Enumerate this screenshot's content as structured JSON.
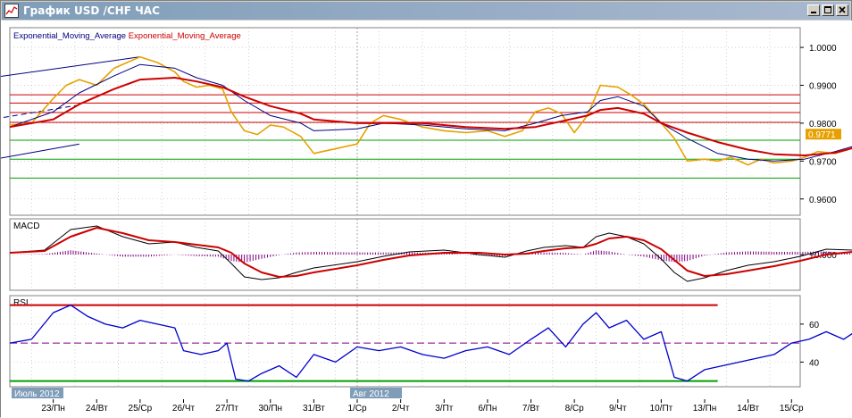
{
  "window": {
    "title": "График USD /CHF ЧАС",
    "controls": [
      "minimize",
      "maximize",
      "close"
    ],
    "app_icon": "chart-icon"
  },
  "colors": {
    "background": "#ffffff",
    "grid": "#b4b4b4",
    "price": "#e6a100",
    "ema_fast": "#000080",
    "ema_slow": "#cc0000",
    "channel": "#000080",
    "resistance": "#cc0000",
    "support": "#00a000",
    "macd_hist": "#800080",
    "rsi": "#0000cc",
    "rsi_overbought": "#cc0000",
    "rsi_oversold": "#00a000",
    "rsi_mid": "#800080",
    "price_tag": "#e6a100"
  },
  "chart_data": [
    {
      "type": "line",
      "panel": "price",
      "legend": [
        "Exponential_Moving_Average",
        "Exponential_Moving_Average"
      ],
      "y_ticks": [
        "1.0000",
        "0.9900",
        "0.9800",
        "0.9700",
        "0.9600"
      ],
      "ylim": [
        0.9557,
        1.0052
      ],
      "current_price": "0.9771",
      "horizontal_levels": {
        "resistance": [
          0.9875,
          0.9853,
          0.9828,
          0.9802
        ],
        "support": [
          0.9755,
          0.9705,
          0.9655
        ]
      },
      "trendlines": [
        {
          "name": "upper channel",
          "from": [
            25,
            0.9975
          ],
          "to": [
            15.2,
            0.9818
          ]
        },
        {
          "name": "middle channel",
          "from": [
            23.6,
            0.9848
          ],
          "to": [
            15.2,
            0.969
          ]
        },
        {
          "name": "lower channel",
          "from": [
            23.6,
            0.9745
          ],
          "to": [
            15.2,
            0.9572
          ]
        }
      ],
      "series": [
        {
          "name": "",
          "role": "price",
          "x": [
            22,
            22.5,
            23,
            23.3,
            23.6,
            24,
            24.4,
            24.8,
            25,
            25.4,
            25.8,
            26,
            26.3,
            26.6,
            26.9,
            27.1,
            27.4,
            27.7,
            28,
            28.3,
            28.7,
            29,
            30,
            30.3,
            30.6,
            31,
            31.5,
            32,
            32.5,
            33,
            33.4,
            33.8,
            34.1,
            34.4,
            34.7,
            35,
            35.3,
            35.6,
            36,
            36.3,
            36.6,
            37,
            37.3,
            37.6,
            38,
            38.3,
            38.6,
            39,
            39.3,
            39.6,
            40,
            40.3,
            40.6,
            41,
            41.3,
            41.6,
            42,
            42.3,
            42.6,
            43,
            43.3,
            43.6
          ],
          "y": [
            0.9795,
            0.98,
            0.9865,
            0.99,
            0.9915,
            0.99,
            0.9945,
            0.9965,
            0.9975,
            0.996,
            0.9935,
            0.991,
            0.9895,
            0.99,
            0.989,
            0.983,
            0.978,
            0.977,
            0.9795,
            0.979,
            0.9765,
            0.972,
            0.9745,
            0.98,
            0.982,
            0.981,
            0.979,
            0.978,
            0.9775,
            0.978,
            0.9765,
            0.978,
            0.983,
            0.984,
            0.9825,
            0.9775,
            0.982,
            0.99,
            0.9895,
            0.9875,
            0.985,
            0.98,
            0.976,
            0.97,
            0.9705,
            0.97,
            0.971,
            0.969,
            0.9705,
            0.9695,
            0.97,
            0.971,
            0.9725,
            0.972,
            0.973,
            0.9745,
            0.9775,
            0.9795,
            0.9785,
            0.98,
            0.9775,
            0.9771
          ]
        },
        {
          "name": "",
          "role": "ema_fast",
          "x": [
            22,
            23,
            23.6,
            24.4,
            25,
            25.8,
            26.3,
            26.9,
            27.4,
            28,
            28.7,
            29,
            30,
            30.6,
            31.5,
            32.5,
            33.4,
            34.1,
            34.7,
            35.3,
            35.6,
            36,
            36.6,
            37,
            37.6,
            38.3,
            39,
            39.6,
            40.3,
            41,
            41.6,
            42.3,
            43,
            43.6
          ],
          "y": [
            0.979,
            0.983,
            0.988,
            0.9925,
            0.9955,
            0.9945,
            0.992,
            0.99,
            0.986,
            0.982,
            0.98,
            0.978,
            0.9785,
            0.98,
            0.9795,
            0.9785,
            0.978,
            0.98,
            0.982,
            0.983,
            0.986,
            0.987,
            0.9845,
            0.98,
            0.976,
            0.972,
            0.9705,
            0.97,
            0.9705,
            0.9725,
            0.9745,
            0.9765,
            0.978,
            0.9778
          ]
        },
        {
          "name": "",
          "role": "ema_slow",
          "x": [
            22,
            23,
            23.6,
            24.4,
            25,
            25.8,
            26.3,
            26.9,
            27.4,
            28,
            28.7,
            29,
            30,
            30.6,
            31.5,
            32.5,
            33.4,
            34.1,
            34.7,
            35.3,
            35.6,
            36,
            36.6,
            37,
            37.6,
            38.3,
            39,
            39.6,
            40.3,
            41,
            41.6,
            42.3,
            43,
            43.6
          ],
          "y": [
            0.979,
            0.981,
            0.985,
            0.989,
            0.9915,
            0.992,
            0.991,
            0.9895,
            0.987,
            0.9845,
            0.9825,
            0.981,
            0.98,
            0.98,
            0.98,
            0.979,
            0.9785,
            0.979,
            0.9805,
            0.982,
            0.9835,
            0.984,
            0.9825,
            0.98,
            0.9775,
            0.975,
            0.973,
            0.9718,
            0.9715,
            0.9722,
            0.974,
            0.9752,
            0.976,
            0.9762
          ]
        }
      ]
    },
    {
      "type": "line",
      "panel": "macd",
      "label": "MACD",
      "y_ticks": [
        "+0.000"
      ],
      "ylim": [
        -0.004,
        0.004
      ],
      "series": [
        {
          "name": "",
          "role": "macd",
          "x": [
            22,
            22.8,
            23.4,
            24,
            24.6,
            25.2,
            25.8,
            26.3,
            26.8,
            27.1,
            27.4,
            27.8,
            28.2,
            28.6,
            29,
            30,
            30.6,
            31.2,
            32,
            32.8,
            33.4,
            33.9,
            34.3,
            34.8,
            35.2,
            35.5,
            35.8,
            36.2,
            36.6,
            37,
            37.3,
            37.6,
            38,
            38.5,
            39,
            39.6,
            40.2,
            40.8,
            41.4,
            42,
            42.5,
            43,
            43.6
          ],
          "y": [
            0.0002,
            0.0005,
            0.0028,
            0.0032,
            0.002,
            0.0012,
            0.0014,
            0.0008,
            0.0004,
            -0.001,
            -0.0025,
            -0.0028,
            -0.0026,
            -0.002,
            -0.0015,
            -0.0008,
            -0.0002,
            0.0003,
            0.0005,
            0.0,
            -0.0003,
            0.0004,
            0.0008,
            0.001,
            0.0008,
            0.002,
            0.0024,
            0.002,
            0.0012,
            -0.0005,
            -0.002,
            -0.003,
            -0.0026,
            -0.0018,
            -0.0012,
            -0.0008,
            -0.0002,
            0.0006,
            0.0005,
            0.0012,
            0.0016,
            0.0012,
            0.0006
          ]
        },
        {
          "name": "",
          "role": "signal",
          "x": [
            22,
            22.8,
            23.4,
            24,
            24.6,
            25.2,
            25.8,
            26.3,
            26.8,
            27.1,
            27.4,
            27.8,
            28.2,
            28.6,
            29,
            30,
            30.6,
            31.2,
            32,
            32.8,
            33.4,
            33.9,
            34.3,
            34.8,
            35.2,
            35.5,
            35.8,
            36.2,
            36.6,
            37,
            37.3,
            37.6,
            38,
            38.5,
            39,
            39.6,
            40.2,
            40.8,
            41.4,
            42,
            42.5,
            43,
            43.6
          ],
          "y": [
            0.0002,
            0.0004,
            0.002,
            0.003,
            0.0024,
            0.0016,
            0.0014,
            0.0011,
            0.0008,
            0.0002,
            -0.001,
            -0.002,
            -0.0025,
            -0.0024,
            -0.002,
            -0.0012,
            -0.0006,
            -0.0001,
            0.0002,
            0.0002,
            0.0,
            0.0001,
            0.0004,
            0.0007,
            0.0008,
            0.0012,
            0.0018,
            0.002,
            0.0016,
            0.0006,
            -0.0006,
            -0.0018,
            -0.0024,
            -0.0022,
            -0.0018,
            -0.0013,
            -0.0007,
            0.0,
            0.0003,
            0.0008,
            0.0012,
            0.0012,
            0.0008
          ]
        }
      ]
    },
    {
      "type": "line",
      "panel": "rsi",
      "label": "RSI",
      "y_ticks": [
        "60",
        "40"
      ],
      "ylim": [
        27,
        75
      ],
      "levels": {
        "overbought": 70,
        "middle": 50,
        "oversold": 30
      },
      "series": [
        {
          "name": "",
          "role": "rsi",
          "x": [
            22,
            22.5,
            23,
            23.4,
            23.8,
            24.2,
            24.6,
            25,
            25.4,
            25.8,
            26,
            26.4,
            26.8,
            27,
            27.2,
            27.5,
            27.8,
            28.2,
            28.6,
            29,
            29.5,
            30,
            30.5,
            31,
            31.5,
            32,
            32.5,
            33,
            33.5,
            34,
            34.4,
            34.8,
            35.2,
            35.5,
            35.8,
            36.2,
            36.6,
            37,
            37.3,
            37.6,
            38,
            38.4,
            38.8,
            39.2,
            39.6,
            40,
            40.4,
            40.8,
            41.2,
            41.6,
            42,
            42.3,
            42.6,
            43,
            43.3,
            43.6
          ],
          "y": [
            50,
            52,
            66,
            70,
            64,
            60,
            58,
            62,
            60,
            58,
            46,
            44,
            46,
            50,
            31,
            30,
            34,
            38,
            32,
            44,
            40,
            48,
            46,
            48,
            44,
            42,
            46,
            48,
            44,
            52,
            58,
            48,
            60,
            66,
            58,
            62,
            52,
            56,
            32,
            30,
            36,
            38,
            40,
            42,
            44,
            50,
            52,
            56,
            52,
            58,
            64,
            62,
            66,
            52,
            56,
            52
          ]
        }
      ]
    }
  ],
  "x_axis": {
    "labels": [
      {
        "x": 23,
        "text": "23/Пн"
      },
      {
        "x": 24,
        "text": "24/Вт"
      },
      {
        "x": 25,
        "text": "25/Ср"
      },
      {
        "x": 26,
        "text": "26/Чт"
      },
      {
        "x": 27,
        "text": "27/Пт"
      },
      {
        "x": 28,
        "text": "30/Пн"
      },
      {
        "x": 29,
        "text": "31/Вт"
      },
      {
        "x": 30,
        "text": "1/Ср"
      },
      {
        "x": 31,
        "text": "2/Чт"
      },
      {
        "x": 32,
        "text": "3/Пт"
      },
      {
        "x": 33,
        "text": "6/Пн"
      },
      {
        "x": 34,
        "text": "7/Вт"
      },
      {
        "x": 35,
        "text": "8/Ср"
      },
      {
        "x": 36,
        "text": "9/Чт"
      },
      {
        "x": 37,
        "text": "10/Пт"
      },
      {
        "x": 38,
        "text": "13/Пн"
      },
      {
        "x": 39,
        "text": "14/Вт"
      },
      {
        "x": 40,
        "text": "15/Ср"
      }
    ],
    "month_labels": [
      {
        "x": 22,
        "text": "Июль 2012"
      },
      {
        "x": 30,
        "text": "Авг 2012"
      }
    ],
    "month_divider_x": 30
  }
}
